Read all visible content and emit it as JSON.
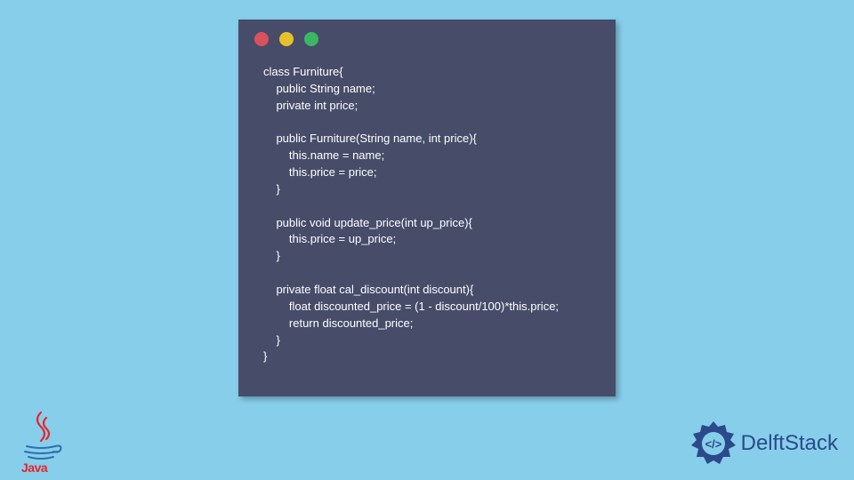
{
  "code": {
    "line1": "class Furniture{",
    "line2": "    public String name;",
    "line3": "    private int price;",
    "line4": "",
    "line5": "    public Furniture(String name, int price){",
    "line6": "        this.name = name;",
    "line7": "        this.price = price;",
    "line8": "    }",
    "line9": "",
    "line10": "    public void update_price(int up_price){",
    "line11": "        this.price = up_price;",
    "line12": "    }",
    "line13": "",
    "line14": "    private float cal_discount(int discount){",
    "line15": "        float discounted_price = (1 - discount/100)*this.price;",
    "line16": "        return discounted_price;",
    "line17": "    }",
    "line18": "}"
  },
  "logos": {
    "java_label": "Java",
    "delft_label": "DelftStack"
  },
  "colors": {
    "background": "#87ceeb",
    "window_bg": "#474c69",
    "red": "#d9515d",
    "yellow": "#e6c029",
    "green": "#3bb662",
    "java_red": "#e8242a",
    "java_blue": "#2f6fb0",
    "delft_blue": "#2b4a8b"
  }
}
